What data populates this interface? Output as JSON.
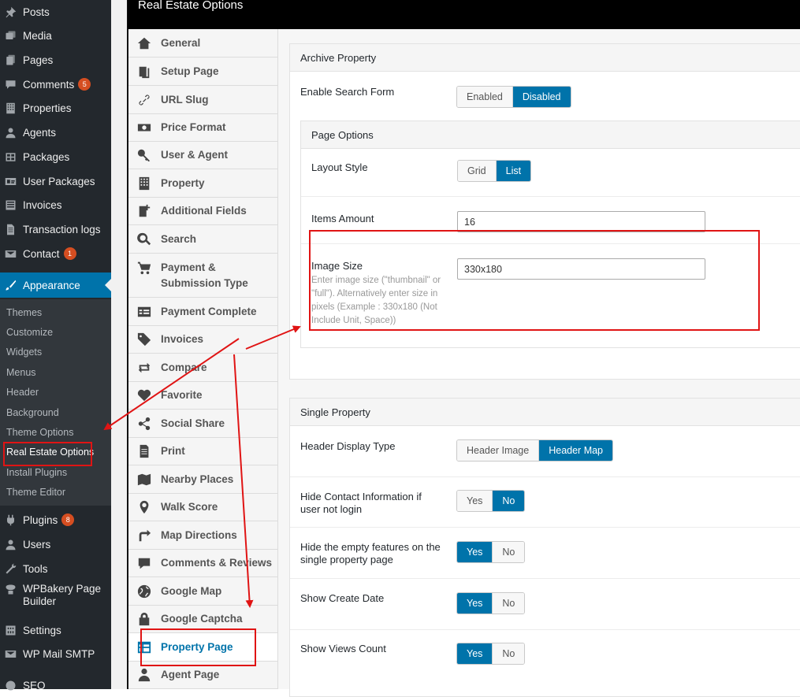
{
  "sidebar": {
    "items": [
      {
        "label": "Posts",
        "icon": "pin-icon"
      },
      {
        "label": "Media",
        "icon": "media-icon"
      },
      {
        "label": "Pages",
        "icon": "pages-icon"
      },
      {
        "label": "Comments",
        "icon": "comments-icon",
        "badge": "5"
      },
      {
        "label": "Properties",
        "icon": "building-icon"
      },
      {
        "label": "Agents",
        "icon": "user-icon"
      },
      {
        "label": "Packages",
        "icon": "grid-icon"
      },
      {
        "label": "User Packages",
        "icon": "id-card-icon"
      },
      {
        "label": "Invoices",
        "icon": "list-icon"
      },
      {
        "label": "Transaction logs",
        "icon": "document-icon"
      },
      {
        "label": "Contact",
        "icon": "mail-icon",
        "badge": "1"
      },
      {
        "label": "Appearance",
        "icon": "brush-icon"
      }
    ],
    "submenu": [
      "Themes",
      "Customize",
      "Widgets",
      "Menus",
      "Header",
      "Background",
      "Theme Options",
      "Real Estate Options",
      "Install Plugins",
      "Theme Editor"
    ],
    "bottom_items": [
      {
        "label": "Plugins",
        "icon": "plugin-icon",
        "badge": "8"
      },
      {
        "label": "Users",
        "icon": "users-icon"
      },
      {
        "label": "Tools",
        "icon": "wrench-icon"
      },
      {
        "label": "WPBakery Page Builder",
        "icon": "wpbakery-icon"
      },
      {
        "label": "Settings",
        "icon": "settings-icon"
      },
      {
        "label": "WP Mail SMTP",
        "icon": "smtp-icon"
      },
      {
        "label": "SEO",
        "icon": "seo-icon"
      }
    ]
  },
  "panel": {
    "title": "Real Estate Options",
    "menu": [
      {
        "label": "General",
        "icon": "home-icon"
      },
      {
        "label": "Setup Page",
        "icon": "copy-icon"
      },
      {
        "label": "URL Slug",
        "icon": "link-icon"
      },
      {
        "label": "Price Format",
        "icon": "money-icon"
      },
      {
        "label": "User & Agent",
        "icon": "key-icon"
      },
      {
        "label": "Property",
        "icon": "building-icon"
      },
      {
        "label": "Additional Fields",
        "icon": "add-file-icon"
      },
      {
        "label": "Search",
        "icon": "search-icon"
      },
      {
        "label": "Payment & Submission Type",
        "icon": "cart-icon"
      },
      {
        "label": "Payment Complete",
        "icon": "receipt-icon"
      },
      {
        "label": "Invoices",
        "icon": "tags-icon"
      },
      {
        "label": "Compare",
        "icon": "compare-icon"
      },
      {
        "label": "Favorite",
        "icon": "heart-icon"
      },
      {
        "label": "Social Share",
        "icon": "share-icon"
      },
      {
        "label": "Print",
        "icon": "print-icon"
      },
      {
        "label": "Nearby Places",
        "icon": "map-icon"
      },
      {
        "label": "Walk Score",
        "icon": "marker-icon"
      },
      {
        "label": "Map Directions",
        "icon": "directions-icon"
      },
      {
        "label": "Comments & Reviews",
        "icon": "comment-icon"
      },
      {
        "label": "Google Map",
        "icon": "globe-icon"
      },
      {
        "label": "Google Captcha",
        "icon": "lock-icon"
      },
      {
        "label": "Property Page",
        "icon": "table-icon"
      },
      {
        "label": "Agent Page",
        "icon": "agent-icon"
      }
    ]
  },
  "archive": {
    "title": "Archive Property",
    "enable_search_label": "Enable Search Form",
    "enable_search_options": [
      "Enabled",
      "Disabled"
    ],
    "page_options_title": "Page Options",
    "layout_label": "Layout Style",
    "layout_options": [
      "Grid",
      "List"
    ],
    "items_label": "Items Amount",
    "items_value": "16",
    "image_size_label": "Image Size",
    "image_size_desc": "Enter image size (\"thumbnail\" or \"full\"). Alternatively enter size in pixels (Example : 330x180 (Not Include Unit, Space))",
    "image_size_value": "330x180"
  },
  "single": {
    "title": "Single Property",
    "header_type_label": "Header Display Type",
    "header_type_options": [
      "Header Image",
      "Header Map"
    ],
    "hide_contact_label": "Hide Contact Information if user not login",
    "hide_empty_label": "Hide the empty features on the single property page",
    "show_create_label": "Show Create Date",
    "show_views_label": "Show Views Count",
    "yes": "Yes",
    "no": "No"
  },
  "colors": {
    "accent": "#0073aa",
    "sidebar_bg": "#23282d",
    "annotation_red": "#e01414"
  }
}
